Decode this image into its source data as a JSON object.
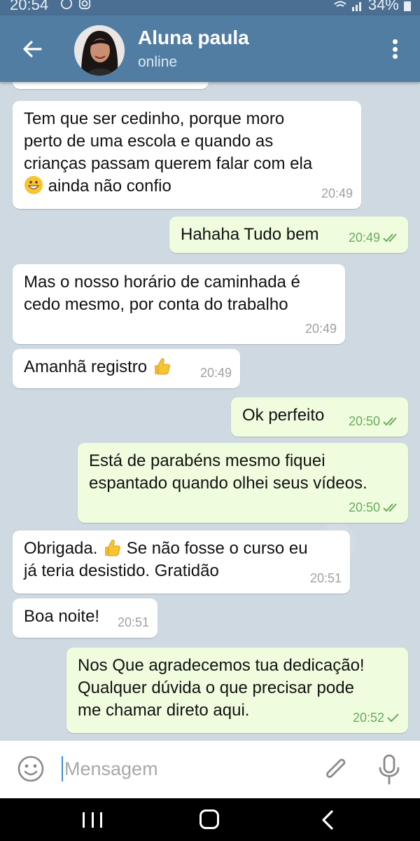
{
  "status_bar": {
    "time": "20:54",
    "battery": "34%",
    "icons": [
      "whatsapp-icon",
      "instagram-icon",
      "wifi-icon",
      "signal-icon",
      "battery-icon"
    ]
  },
  "header": {
    "contact_name": "Aluna paula",
    "contact_status": "online",
    "icons": [
      "back-arrow-icon",
      "avatar",
      "more-vert-icon"
    ]
  },
  "messages": [
    {
      "direction": "in",
      "text": "Tem que ser cedinho, porque moro\nperto de uma escola e quando as\ncrianças passam querem falar com ela\n",
      "emoji_before_tail": "grin-emoji",
      "tail_text": " ainda não confio",
      "time": "20:49"
    },
    {
      "direction": "out",
      "text": "Hahaha Tudo bem",
      "time": "20:49",
      "status": "read"
    },
    {
      "direction": "in",
      "text": "Mas o nosso horário de caminhada é\ncedo mesmo, por conta do trabalho",
      "time": "20:49"
    },
    {
      "direction": "in",
      "text": "Amanhã registro ",
      "emoji": "thumbs-up-emoji",
      "time": "20:49"
    },
    {
      "direction": "out",
      "text": "Ok perfeito",
      "time": "20:50",
      "status": "read"
    },
    {
      "direction": "out",
      "text": "Está de parabéns mesmo fiquei\nespantado quando olhei seus vídeos.",
      "time": "20:50",
      "status": "read"
    },
    {
      "direction": "in",
      "text": "Obrigada. ",
      "emoji": "thumbs-up-emoji",
      "tail_text": " Se não fosse o curso eu\njá teria desistido. Gratidão",
      "time": "20:51"
    },
    {
      "direction": "in",
      "text": "Boa noite!",
      "time": "20:51"
    },
    {
      "direction": "out",
      "text": "Nos Que agradecemos tua dedicação!\nQualquer dúvida o que precisar pode\nme chamar direto aqui.",
      "time": "20:52",
      "status": "sent"
    }
  ],
  "input": {
    "placeholder": "Mensagem",
    "value": "",
    "icons": [
      "emoji-icon",
      "attach-icon",
      "mic-icon"
    ]
  },
  "nav": {
    "icons": [
      "recents-icon",
      "home-icon",
      "back-icon"
    ]
  },
  "colors": {
    "header": "#517da2",
    "status_bar": "#4a6f92",
    "chat_bg": "#cfd9e1",
    "bubble_in": "#ffffff",
    "bubble_out": "#effdde",
    "check_green": "#6aaa5e"
  }
}
